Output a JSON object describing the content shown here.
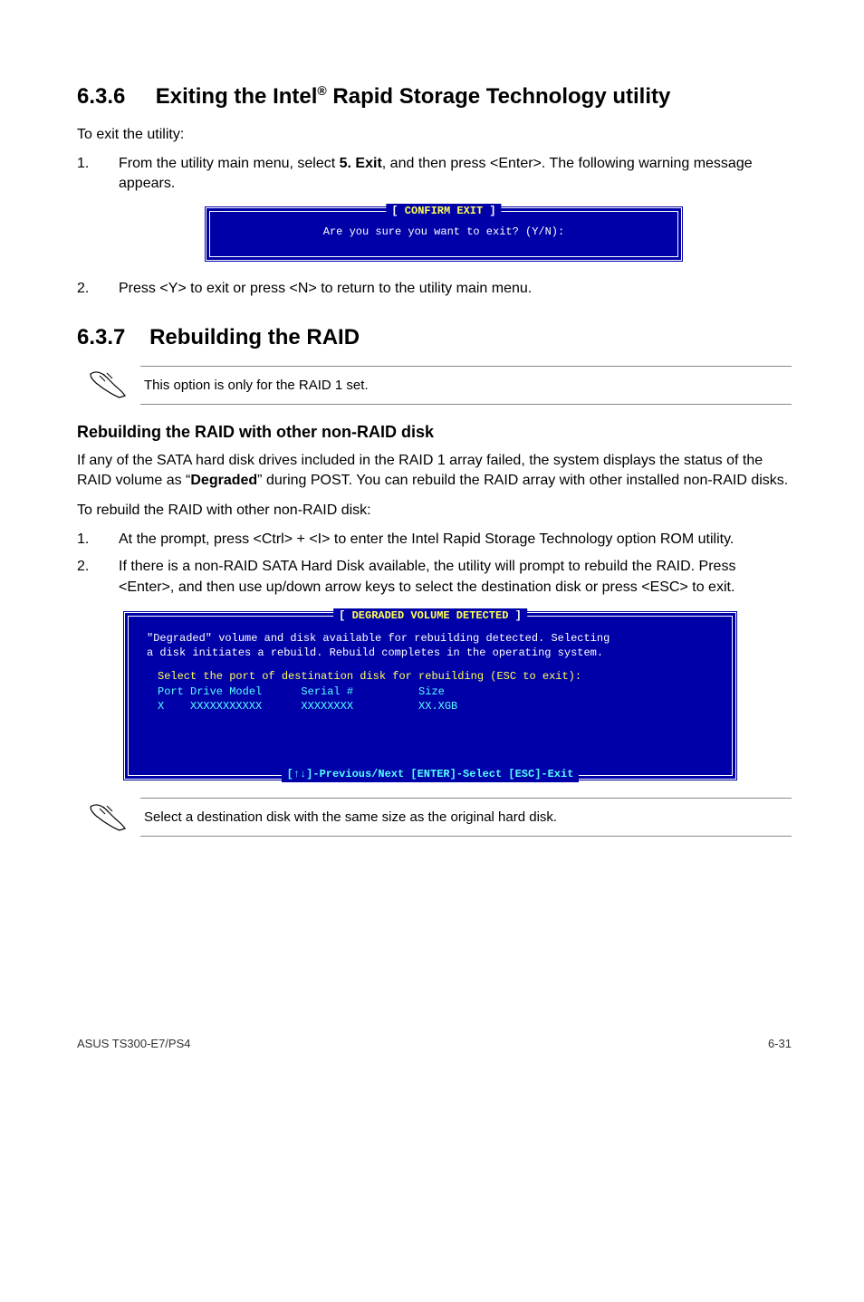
{
  "sections": {
    "s636": {
      "number": "6.3.6",
      "title_a": "Exiting the Intel",
      "title_sup": "®",
      "title_b": " Rapid Storage Technology utility",
      "intro": "To exit the utility:",
      "steps": [
        {
          "n": "1.",
          "text_a": "From the utility main menu, select ",
          "bold": "5. Exit",
          "text_b": ", and then press <Enter>. The following warning message appears."
        },
        {
          "n": "2.",
          "text": "Press <Y> to exit or press <N> to return to the utility main menu."
        }
      ],
      "terminal": {
        "badge": "[ CONFIRM EXIT ]",
        "line": "Are you sure you want to exit? (Y/N):"
      }
    },
    "s637": {
      "number": "6.3.7",
      "title": "Rebuilding the RAID",
      "note1": "This option is only for the RAID 1 set.",
      "subhead": "Rebuilding the RAID with other non-RAID disk",
      "para1_a": "If any of the SATA hard disk drives included in the RAID 1 array failed, the system displays the status of the RAID volume as “",
      "para1_bold": "Degraded",
      "para1_b": "” during POST. You can rebuild the RAID array with other installed non-RAID disks.",
      "para2": "To rebuild the RAID with other non-RAID disk:",
      "steps": [
        {
          "n": "1.",
          "text": "At the prompt, press <Ctrl> + <I> to enter the Intel Rapid Storage Technology option ROM utility."
        },
        {
          "n": "2.",
          "text": "If there is a non-RAID SATA Hard Disk available, the utility will prompt to rebuild the RAID. Press <Enter>, and then use up/down arrow keys to select the destination disk or press <ESC> to exit."
        }
      ],
      "terminal": {
        "badge": "[ DEGRADED VOLUME DETECTED ]",
        "msg1": "\"Degraded\" volume and disk available for rebuilding detected. Selecting",
        "msg2": "a disk initiates a rebuild. Rebuild completes in the operating system.",
        "sel_intro": "Select the port of destination disk for rebuilding (ESC to exit):",
        "hdr": "Port Drive Model      Serial #          Size",
        "row": "X    XXXXXXXXXXX      XXXXXXXX          XX.XGB",
        "footer": "[↑↓]-Previous/Next  [ENTER]-Select  [ESC]-Exit"
      },
      "note2": "Select a destination disk with the same size as the original hard disk."
    }
  },
  "footer": {
    "left": "ASUS TS300-E7/PS4",
    "right": "6-31"
  }
}
